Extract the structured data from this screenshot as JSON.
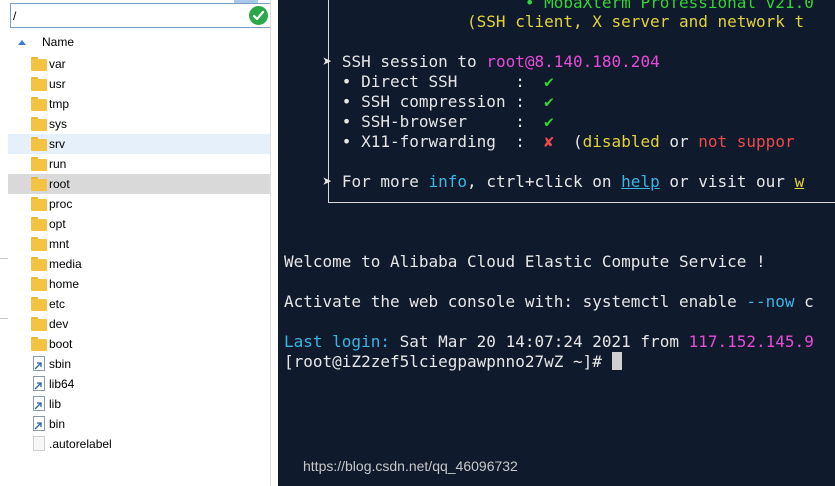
{
  "file_browser": {
    "path_value": "/",
    "column_header": "Name",
    "items": [
      {
        "name": "var",
        "type": "folder"
      },
      {
        "name": "usr",
        "type": "folder"
      },
      {
        "name": "tmp",
        "type": "folder"
      },
      {
        "name": "sys",
        "type": "folder"
      },
      {
        "name": "srv",
        "type": "folder"
      },
      {
        "name": "run",
        "type": "folder"
      },
      {
        "name": "root",
        "type": "folder"
      },
      {
        "name": "proc",
        "type": "folder"
      },
      {
        "name": "opt",
        "type": "folder"
      },
      {
        "name": "mnt",
        "type": "folder"
      },
      {
        "name": "media",
        "type": "folder"
      },
      {
        "name": "home",
        "type": "folder"
      },
      {
        "name": "etc",
        "type": "folder"
      },
      {
        "name": "dev",
        "type": "folder"
      },
      {
        "name": "boot",
        "type": "folder"
      },
      {
        "name": "sbin",
        "type": "symlink"
      },
      {
        "name": "lib64",
        "type": "symlink"
      },
      {
        "name": "lib",
        "type": "symlink"
      },
      {
        "name": "bin",
        "type": "symlink"
      },
      {
        "name": ".autorelabel",
        "type": "file"
      }
    ],
    "hover_item": "srv",
    "selected_item": "root"
  },
  "terminal": {
    "banner_title_bullet": "•",
    "banner_title": "MobaXterm Professional v21.0",
    "banner_subtitle": "(SSH client, X server and network t",
    "ssh_arrow": "➤",
    "ssh_session_label": "SSH session to ",
    "ssh_target": "root@8.140.180.204",
    "bullet": "•",
    "options": [
      {
        "label": "Direct SSH      :",
        "status": "✔"
      },
      {
        "label": "SSH compression :",
        "status": "✔"
      },
      {
        "label": "SSH-browser     :",
        "status": "✔"
      },
      {
        "label": "X11-forwarding  :",
        "status": "✘"
      }
    ],
    "x11_open_paren": "(",
    "x11_disabled": "disabled",
    "x11_or": " or ",
    "x11_not_supported": "not suppor",
    "info_arrow": "➤",
    "info_prefix": "For more ",
    "info_word": "info",
    "info_mid": ", ctrl+click on ",
    "info_help": "help",
    "info_suffix": " or visit our ",
    "info_tail": "w",
    "welcome": "Welcome to Alibaba Cloud Elastic Compute Service !",
    "activate_prefix": "Activate the web console with: systemctl enable ",
    "activate_flag": "--now",
    "activate_suffix": " c",
    "last_login_label": "Last login:",
    "last_login_date": " Sat Mar 20 14:07:24 2021 from ",
    "last_login_ip": "117.152.145.9",
    "prompt": "[root@iZ2zef5lciegpawpnno27wZ ~]# "
  },
  "watermark": "https://blog.csdn.net/qq_46096732",
  "colors": {
    "terminal_bg": "#0f1a2c",
    "green": "#35d435",
    "yellow": "#e3d23a",
    "pink": "#e84bd8",
    "cyan": "#38b6e6",
    "red": "#ee4a4a",
    "status_ok": "#2aa84a",
    "hover_row": "#e5f0fb",
    "selected_row": "#d9d9d9"
  },
  "icons": {
    "path_status": "check-circle-icon",
    "sort": "sort-ascending-icon",
    "folder": "folder-icon",
    "symlink": "symlink-icon",
    "file": "file-icon"
  }
}
